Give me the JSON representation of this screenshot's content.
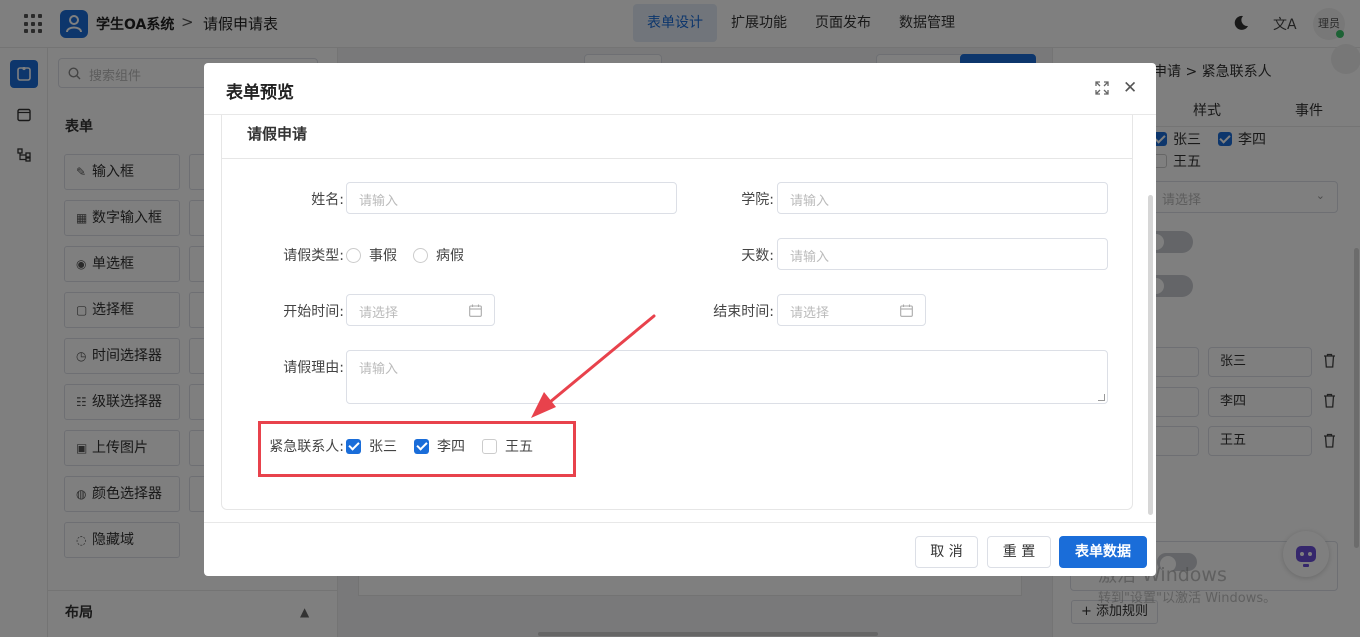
{
  "header": {
    "app_name": "学生OA系统",
    "separator": ">",
    "page_name": "请假申请表",
    "tabs": [
      {
        "label": "表单设计",
        "active": true
      },
      {
        "label": "扩展功能",
        "active": false
      },
      {
        "label": "页面发布",
        "active": false
      },
      {
        "label": "数据管理",
        "active": false
      }
    ],
    "translate_glyph": "文A",
    "avatar_text": "理员"
  },
  "components": {
    "search_placeholder": "搜索组件",
    "section_form": "表单",
    "items": [
      {
        "label": "输入框",
        "icon": "edit-icon",
        "glyph": "✎"
      },
      {
        "label": "数字输入框",
        "icon": "number-icon",
        "glyph": "▦"
      },
      {
        "label": "单选框",
        "icon": "radio-icon",
        "glyph": "◉"
      },
      {
        "label": "选择框",
        "icon": "select-icon",
        "glyph": "▢"
      },
      {
        "label": "时间选择器",
        "icon": "clock-icon",
        "glyph": "◷"
      },
      {
        "label": "级联选择器",
        "icon": "cascader-icon",
        "glyph": "☷"
      },
      {
        "label": "上传图片",
        "icon": "image-icon",
        "glyph": "▣"
      },
      {
        "label": "颜色选择器",
        "icon": "palette-icon",
        "glyph": "◍"
      },
      {
        "label": "隐藏域",
        "icon": "eye-off-icon",
        "glyph": "◌"
      }
    ],
    "section_layout": "布局"
  },
  "properties": {
    "breadcrumb": "申请 > 紧急联系人",
    "tabs": [
      "样式",
      "事件"
    ],
    "checks": [
      {
        "label": "张三",
        "checked": true
      },
      {
        "label": "李四",
        "checked": true
      },
      {
        "label": "王五",
        "checked": false
      }
    ],
    "select_placeholder": "请选择",
    "options": [
      "张三",
      "李四",
      "王五"
    ],
    "add_rule": "+ 添加规则"
  },
  "watermark": {
    "line1": "激活 Windows",
    "line2": "转到\"设置\"以激活 Windows。"
  },
  "modal": {
    "title": "表单预览",
    "close_glyph": "✕",
    "form_title": "请假申请",
    "fields": {
      "name_label": "姓名:",
      "name_placeholder": "请输入",
      "college_label": "学院:",
      "college_placeholder": "请输入",
      "leave_type_label": "请假类型:",
      "leave_type_options": [
        "事假",
        "病假"
      ],
      "days_label": "天数:",
      "days_placeholder": "请输入",
      "start_label": "开始时间:",
      "start_placeholder": "请选择",
      "end_label": "结束时间:",
      "end_placeholder": "请选择",
      "reason_label": "请假理由:",
      "reason_placeholder": "请输入",
      "contact_label": "紧急联系人:",
      "contacts": [
        {
          "label": "张三",
          "checked": true
        },
        {
          "label": "李四",
          "checked": true
        },
        {
          "label": "王五",
          "checked": false
        }
      ]
    },
    "buttons": {
      "cancel": "取 消",
      "reset": "重 置",
      "submit": "表单数据"
    },
    "accent_color": "#1a6dd9",
    "highlight_color": "#e8424c"
  }
}
